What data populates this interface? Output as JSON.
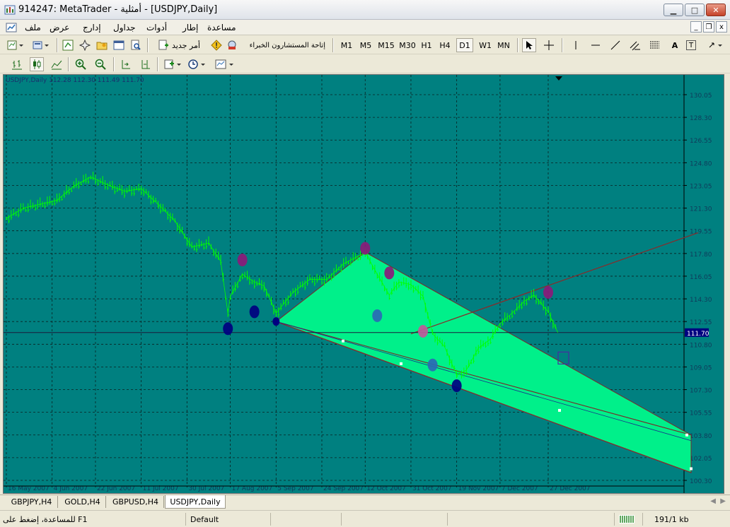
{
  "window": {
    "title": "914247: MetaTrader - أمثلية - [USDJPY,Daily]",
    "buttons": {
      "minimize": "▁",
      "maximize": "□",
      "close": "✕"
    }
  },
  "menubar": {
    "items": [
      "ملف",
      "عرض",
      "إدارج",
      "جداول",
      "أدوات",
      "إطار",
      "مساعدة"
    ],
    "mdi_controls": {
      "minimize": "_",
      "restore": "❐",
      "close": "x"
    }
  },
  "toolbar1": {
    "new_order_label": "أمر جديد",
    "experts_label": "إتاحة المستشارون الخبراء",
    "timeframes": [
      "M1",
      "M5",
      "M15",
      "M30",
      "H1",
      "H4",
      "D1",
      "W1",
      "MN"
    ],
    "active_timeframe": "D1",
    "text_tool": "A",
    "label_tool": "T"
  },
  "chart": {
    "header": "USDJPY,Daily  112.28 112.30 111.49 111.70",
    "current_price": "111.70",
    "background_color": "#008080",
    "price_labels": [
      "130.05",
      "128.30",
      "126.55",
      "124.80",
      "123.05",
      "121.30",
      "119.55",
      "117.80",
      "116.05",
      "114.30",
      "112.55",
      "110.80",
      "109.05",
      "107.30",
      "105.55",
      "103.80",
      "102.05",
      "100.30"
    ],
    "date_labels": [
      "16 May 2007",
      "4 Jun 2007",
      "22 Jun 2007",
      "11 Jul 2007",
      "30 Jul 2007",
      "17 Aug 2007",
      "5 Sep 2007",
      "24 Sep 2007",
      "12 Oct 2007",
      "31 Oct 2007",
      "19 Nov 2007",
      "7 Dec 2007",
      "27 Dec 2007"
    ]
  },
  "chart_data": {
    "type": "line",
    "title": "USDJPY,Daily",
    "ylim": [
      100.3,
      131.0
    ],
    "series": [
      {
        "name": "USDJPY",
        "x": [
          "2007-05-16",
          "2007-05-23",
          "2007-05-30",
          "2007-06-06",
          "2007-06-13",
          "2007-06-20",
          "2007-06-27",
          "2007-07-04",
          "2007-07-11",
          "2007-07-18",
          "2007-07-25",
          "2007-08-01",
          "2007-08-08",
          "2007-08-13",
          "2007-08-16",
          "2007-08-17",
          "2007-08-22",
          "2007-08-27",
          "2007-08-31",
          "2007-09-05",
          "2007-09-12",
          "2007-09-19",
          "2007-09-26",
          "2007-10-03",
          "2007-10-12",
          "2007-10-17",
          "2007-10-22",
          "2007-10-26",
          "2007-10-31",
          "2007-11-05",
          "2007-11-09",
          "2007-11-14",
          "2007-11-19",
          "2007-11-23",
          "2007-11-28",
          "2007-12-03",
          "2007-12-07",
          "2007-12-12",
          "2007-12-17",
          "2007-12-21",
          "2007-12-27",
          "2007-12-31"
        ],
        "y": [
          120.5,
          121.3,
          121.6,
          121.9,
          123.0,
          123.7,
          123.1,
          122.6,
          122.8,
          121.6,
          120.3,
          118.3,
          118.6,
          117.2,
          113.2,
          114.5,
          116.2,
          115.6,
          115.3,
          113.2,
          114.8,
          115.8,
          115.8,
          117.0,
          117.9,
          116.2,
          114.6,
          115.6,
          115.4,
          114.5,
          111.6,
          110.6,
          108.4,
          108.8,
          110.5,
          111.2,
          112.4,
          113.2,
          114.1,
          114.6,
          113.3,
          111.7
        ]
      }
    ]
  },
  "tabs": [
    "GBPJPY,H4",
    "GOLD,H4",
    "GBPUSD,H4",
    "USDJPY,Daily"
  ],
  "active_tab": "USDJPY,Daily",
  "status": {
    "help": "للمساعدة، إضغط على F1",
    "profile": "Default",
    "traffic": "191/1 kb"
  }
}
